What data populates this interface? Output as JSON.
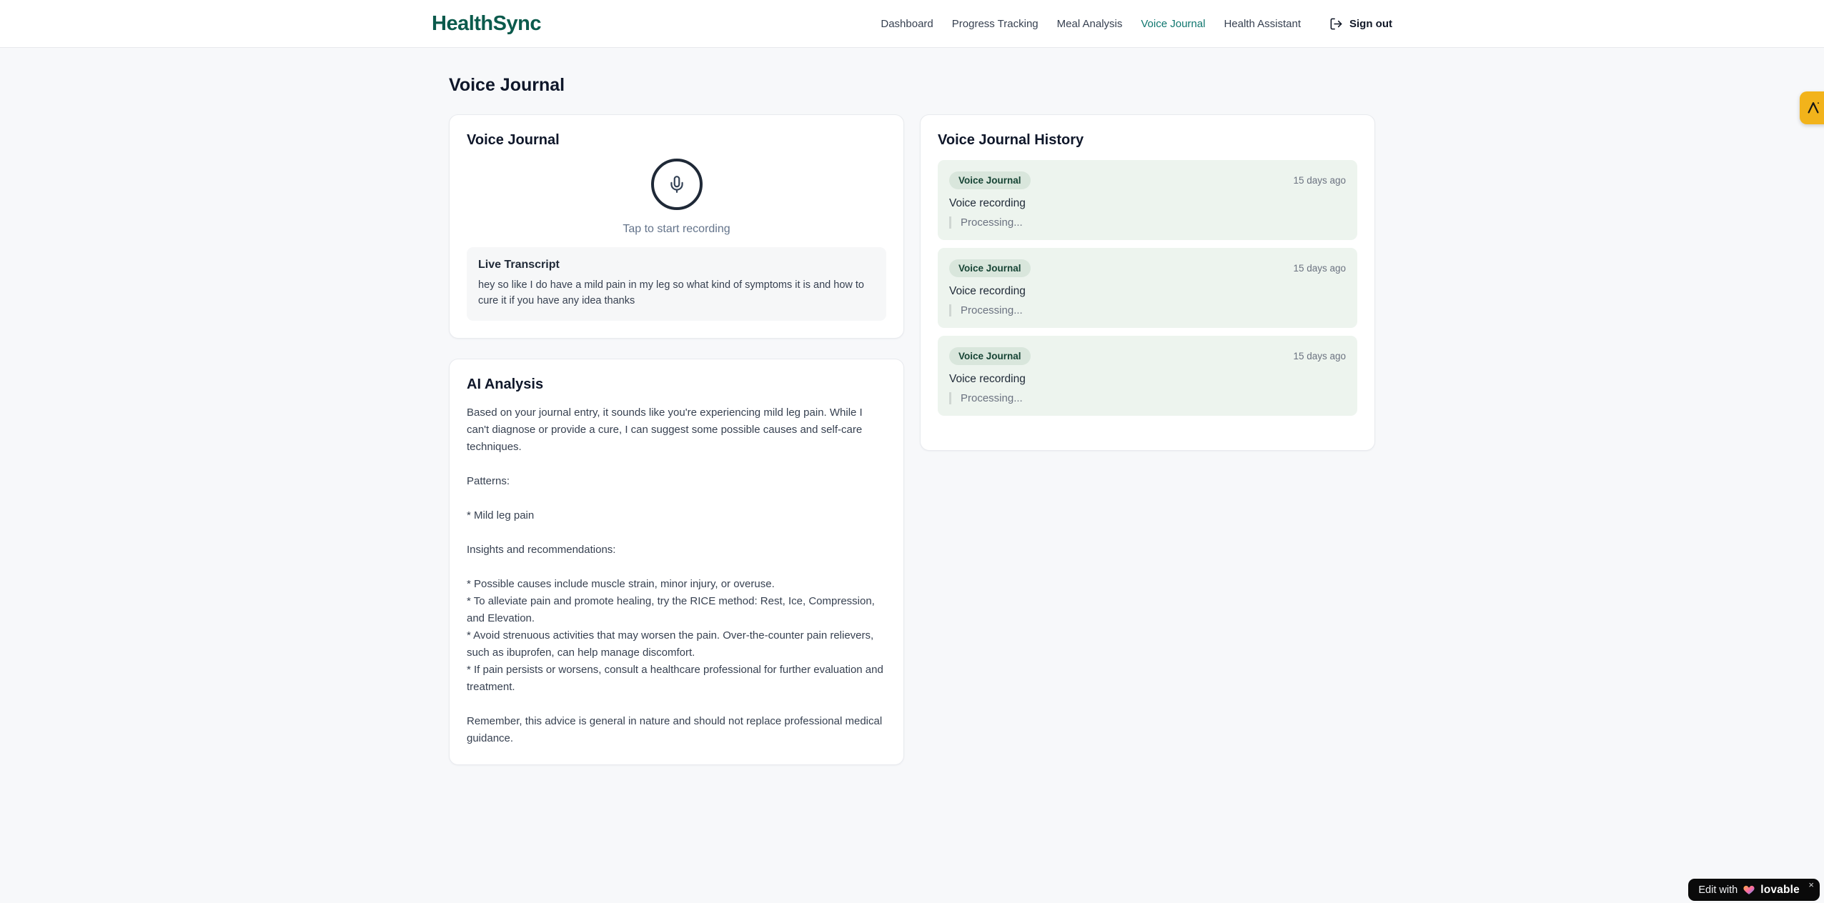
{
  "brand": {
    "name": "HealthSync",
    "color": "#0b5a4c"
  },
  "nav": {
    "items": [
      {
        "label": "Dashboard",
        "active": false
      },
      {
        "label": "Progress Tracking",
        "active": false
      },
      {
        "label": "Meal Analysis",
        "active": false
      },
      {
        "label": "Voice Journal",
        "active": true
      },
      {
        "label": "Health Assistant",
        "active": false
      }
    ],
    "sign_out_label": "Sign out"
  },
  "page": {
    "title": "Voice Journal"
  },
  "recorder": {
    "card_title": "Voice Journal",
    "tap_hint": "Tap to start recording",
    "transcript_title": "Live Transcript",
    "transcript_text": "hey so like I do have a mild pain in my leg so what kind of symptoms it is and how to cure it if you have any idea thanks"
  },
  "analysis": {
    "card_title": "AI Analysis",
    "body": "Based on your journal entry, it sounds like you're experiencing mild leg pain. While I can't diagnose or provide a cure, I can suggest some possible causes and self-care techniques.\n\nPatterns:\n\n* Mild leg pain\n\nInsights and recommendations:\n\n* Possible causes include muscle strain, minor injury, or overuse.\n* To alleviate pain and promote healing, try the RICE method: Rest, Ice, Compression, and Elevation.\n* Avoid strenuous activities that may worsen the pain. Over-the-counter pain relievers, such as ibuprofen, can help manage discomfort.\n* If pain persists or worsens, consult a healthcare professional for further evaluation and treatment.\n\nRemember, this advice is general in nature and should not replace professional medical guidance."
  },
  "history": {
    "card_title": "Voice Journal History",
    "entries": [
      {
        "badge": "Voice Journal",
        "time": "15 days ago",
        "title": "Voice recording",
        "status": "Processing..."
      },
      {
        "badge": "Voice Journal",
        "time": "15 days ago",
        "title": "Voice recording",
        "status": "Processing..."
      },
      {
        "badge": "Voice Journal",
        "time": "15 days ago",
        "title": "Voice recording",
        "status": "Processing..."
      }
    ]
  },
  "lovable": {
    "edit_prefix": "Edit with",
    "brand": "lovable",
    "close": "×"
  },
  "colors": {
    "brand_green": "#0b5a4c",
    "nav_active_teal": "#0f766e",
    "history_entry_bg": "#edf4ee",
    "badge_bg": "#d9e6dc",
    "badge_text": "#164434",
    "side_button_amber": "#f2b31b",
    "lovable_badge_bg": "#0a0a0a",
    "page_bg": "#f7f8fa"
  }
}
